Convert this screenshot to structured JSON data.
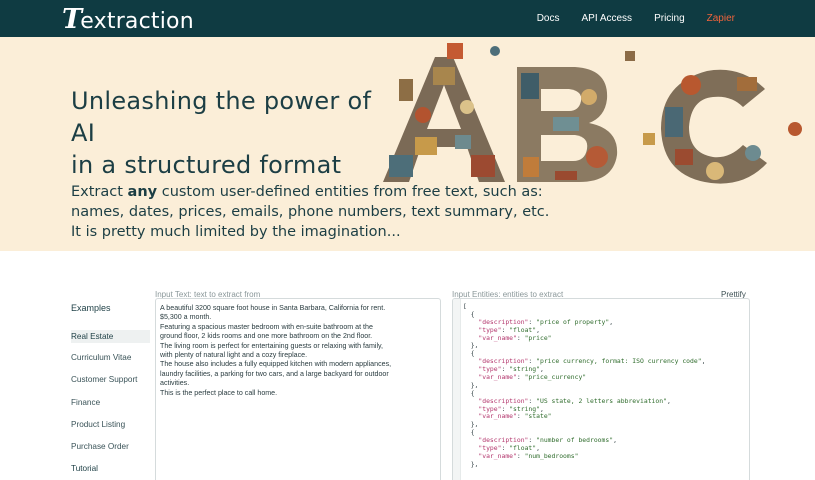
{
  "nav": {
    "logo": "extraction",
    "logo_initial": "T",
    "links": [
      {
        "label": "Docs"
      },
      {
        "label": "API Access"
      },
      {
        "label": "Pricing"
      },
      {
        "label": "Zapier"
      }
    ],
    "accent_color": "#f0643c"
  },
  "hero": {
    "headline_line1": "Unleashing the power of AI",
    "headline_line2": "in a structured format",
    "sub_pre": "Extract ",
    "sub_bold": "any",
    "sub_post": " custom user-defined entities from free text, such as:",
    "sub_line2": "names, dates, prices, emails, phone numbers, text summary, etc.",
    "sub_line3": "It is pretty much limited by the imagination..."
  },
  "sidebar": {
    "title": "Examples",
    "items": [
      {
        "label": "Real Estate",
        "active": true
      },
      {
        "label": "Curriculum Vitae"
      },
      {
        "label": "Customer Support"
      },
      {
        "label": "Finance"
      },
      {
        "label": "Product Listing"
      },
      {
        "label": "Purchase Order"
      },
      {
        "label": "Tutorial"
      }
    ]
  },
  "input_text": {
    "label": "Input Text: text to extract from",
    "value": "A beautiful 3200 square foot house in Santa Barbara, California for rent.\n$5,300 a month.\nFeaturing a spacious master bedroom with en-suite bathroom at the\nground floor, 2 kids rooms and one more bathroom on the 2nd floor.\nThe living room is perfect for entertaining guests or relaxing with family,\nwith plenty of natural light and a cozy fireplace.\nThe house also includes a fully equipped kitchen with modern appliances,\nlaundry facilities, a parking for two cars, and a large backyard for outdoor\nactivities.\nThis is the perfect place to call home."
  },
  "input_entities": {
    "label": "Input Entities: entities to extract",
    "prettify_label": "Prettify",
    "entities": [
      {
        "description": "price of property",
        "type": "float",
        "var_name": "price"
      },
      {
        "description": "price currency, format: ISO currency code",
        "type": "string",
        "var_name": "price_currency"
      },
      {
        "description": "US state, 2 letters abbreviation",
        "type": "string",
        "var_name": "state"
      },
      {
        "description": "number of bedrooms",
        "type": "float",
        "var_name": "num_bedrooms"
      }
    ]
  }
}
